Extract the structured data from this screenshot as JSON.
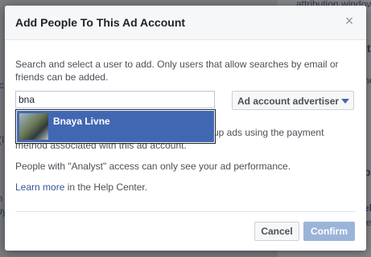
{
  "background": {
    "left_fragments": [
      "ic",
      "(I",
      "lh",
      "uy"
    ],
    "right_fragments": [
      "attribution window,",
      "lt",
      "ne",
      "pl",
      "el",
      "ie"
    ]
  },
  "dialog": {
    "title": "Add People To This Ad Account",
    "close_icon": "×",
    "description": "Search and select a user to add. Only users that allow searches by email or friends can be added.",
    "search": {
      "value": "bna",
      "placeholder": ""
    },
    "role_select": {
      "selected": "Ad account advertiser"
    },
    "suggestions": [
      {
        "name": "Bnaya Livne"
      }
    ],
    "payment_text_visible": "up ads using the payment",
    "payment_text_line2": "method associated with this ad account.",
    "analyst_text": "People with \"Analyst\" access can only see your ad performance.",
    "help": {
      "link": "Learn more",
      "suffix": " in the Help Center."
    },
    "buttons": {
      "cancel": "Cancel",
      "confirm": "Confirm"
    }
  },
  "colors": {
    "accent": "#4267b2",
    "link": "#365899",
    "confirm_disabled": "#9cb4d8"
  }
}
